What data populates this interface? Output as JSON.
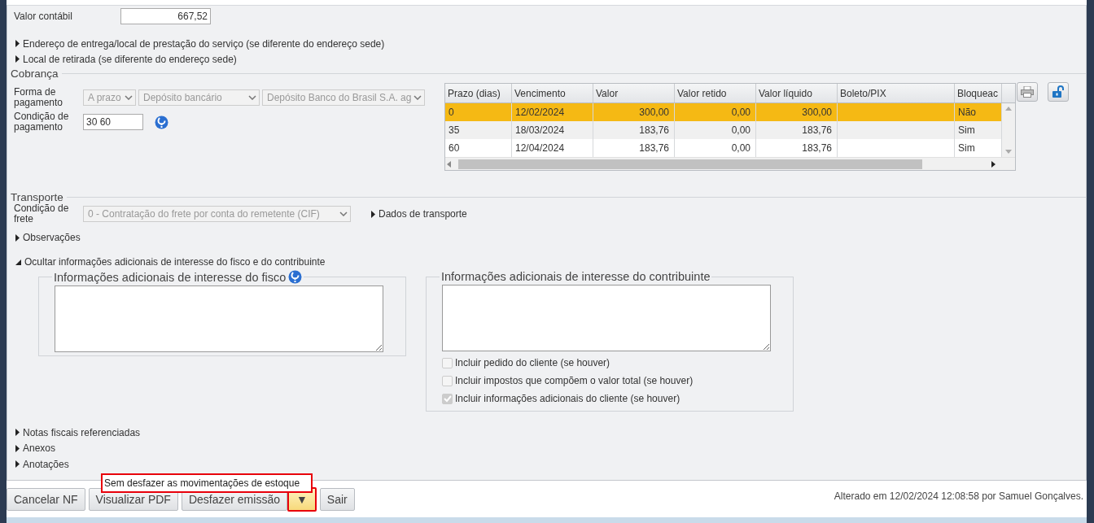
{
  "valor_contabil": {
    "label": "Valor contábil",
    "value": "667,52"
  },
  "sections_top": [
    {
      "label": "Endereço de entrega/local de prestação do serviço (se diferente do endereço sede)",
      "expanded": false
    },
    {
      "label": "Local de retirada (se diferente do endereço sede)",
      "expanded": false
    }
  ],
  "cobranca": {
    "title": "Cobrança",
    "forma_label": "Forma de pagamento",
    "selects": [
      "A prazo",
      "Depósito bancário",
      "Depósito Banco do Brasil S.A. ag"
    ],
    "condicao_label": "Condição de pagamento",
    "condicao_value": "30 60",
    "table": {
      "columns": [
        "Prazo (dias)",
        "Vencimento",
        "Valor",
        "Valor retido",
        "Valor líquido",
        "Boleto/PIX",
        "Bloqueac"
      ],
      "rows": [
        {
          "cells": [
            "0",
            "12/02/2024",
            "300,00",
            "0,00",
            "300,00",
            "",
            "Não"
          ],
          "selected": true
        },
        {
          "cells": [
            "35",
            "18/03/2024",
            "183,76",
            "0,00",
            "183,76",
            "",
            "Sim"
          ],
          "selected": false
        },
        {
          "cells": [
            "60",
            "12/04/2024",
            "183,76",
            "0,00",
            "183,76",
            "",
            "Sim"
          ],
          "selected": false
        }
      ]
    }
  },
  "transporte": {
    "title": "Transporte",
    "frete_label": "Condição de frete",
    "frete_value": "0 - Contratação do frete por conta do remetente (CIF)",
    "dados": {
      "label": "Dados de transporte",
      "expanded": false
    }
  },
  "sections_mid": [
    {
      "label": "Observações",
      "expanded": false
    },
    {
      "label": "Ocultar informações adicionais de interesse do fisco e do contribuinte",
      "expanded": true
    }
  ],
  "fisco": {
    "title": "Informações adicionais de interesse do fisco"
  },
  "contribuinte": {
    "title": "Informações adicionais de interesse do contribuinte",
    "options": [
      {
        "label": "Incluir pedido do cliente (se houver)",
        "checked": false
      },
      {
        "label": "Incluir impostos que compõem o valor total (se houver)",
        "checked": false
      },
      {
        "label": "Incluir informações adicionais do cliente (se houver)",
        "checked": true
      }
    ]
  },
  "sections_bottom": [
    {
      "label": "Notas fiscais referenciadas",
      "expanded": false
    },
    {
      "label": "Anexos",
      "expanded": false
    },
    {
      "label": "Anotações",
      "expanded": false
    }
  ],
  "menu": {
    "items": [
      {
        "label": "Sem desfazer as movimentações de estoque",
        "highlighted": true
      }
    ]
  },
  "buttons": [
    {
      "kind": "button",
      "label": "Cancelar NF",
      "highlighted": false
    },
    {
      "kind": "button",
      "label": "Visualizar PDF",
      "highlighted": false
    },
    {
      "kind": "button",
      "label": "Desfazer emissão",
      "highlighted": false
    },
    {
      "kind": "dropdown",
      "label": "▼",
      "highlighted": true
    },
    {
      "kind": "button",
      "label": "Sair",
      "highlighted": false
    }
  ],
  "footer": "Alterado em 12/02/2024 12:08:58 por Samuel Gonçalves."
}
